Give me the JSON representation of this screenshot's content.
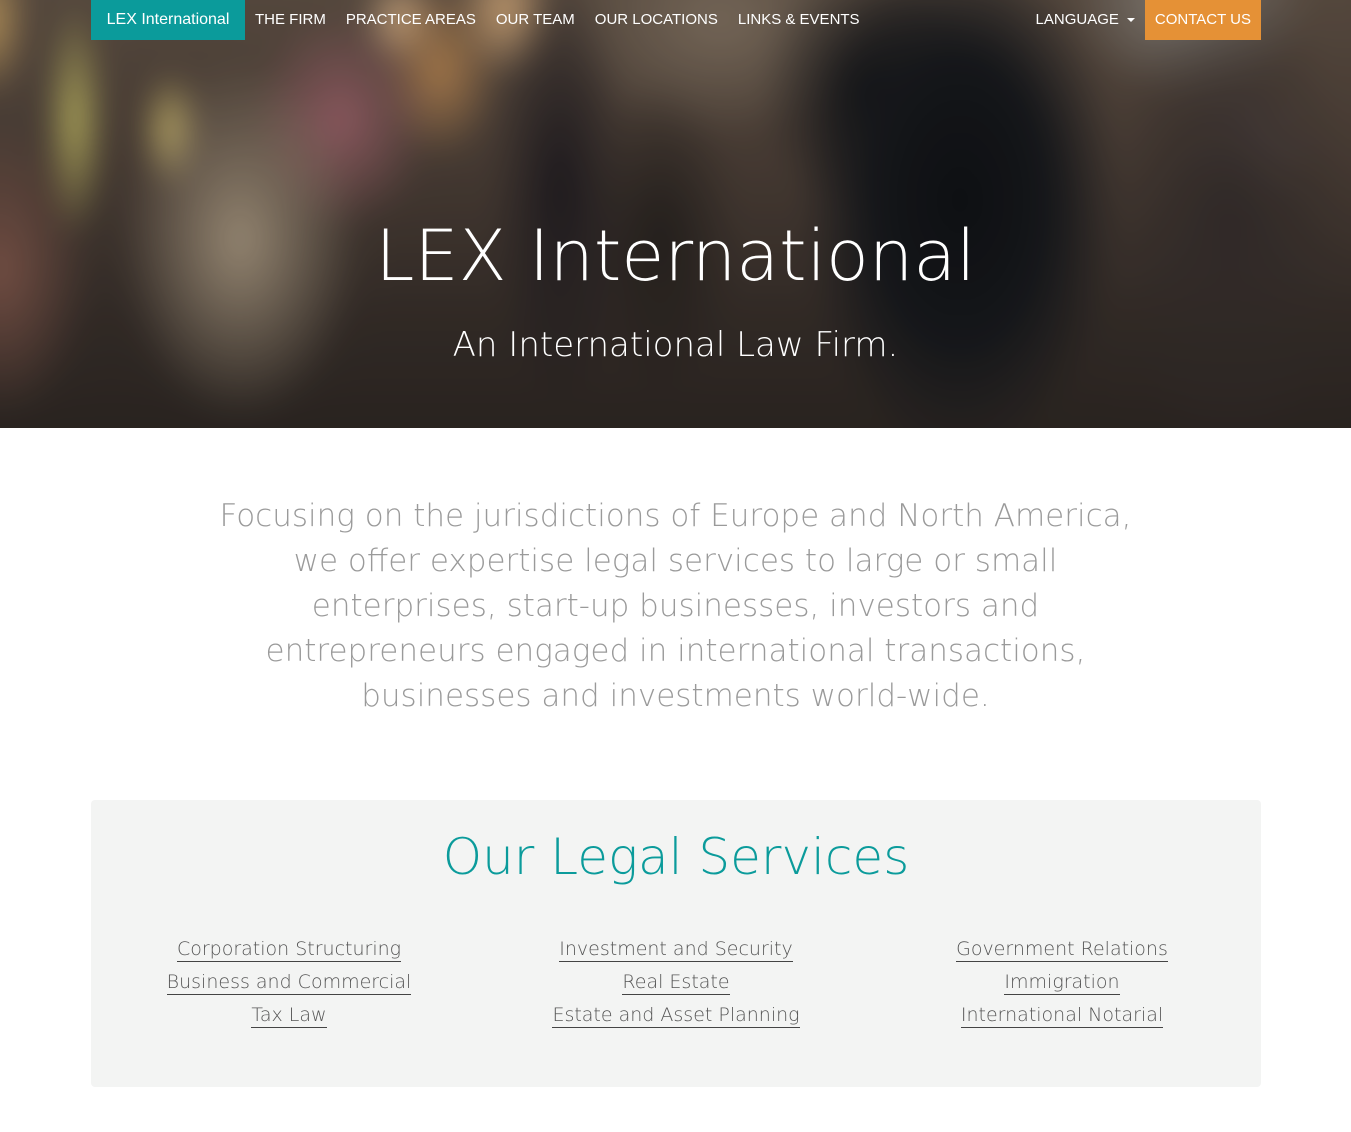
{
  "navbar": {
    "brand": "LEX International",
    "links": [
      "THE FIRM",
      "PRACTICE AREAS",
      "OUR TEAM",
      "OUR LOCATIONS",
      "LINKS & EVENTS"
    ],
    "language_label": "LANGUAGE",
    "contact_label": "CONTACT US",
    "brand_color": "#0b9b9b",
    "contact_color": "#e59136"
  },
  "hero": {
    "title": "LEX International",
    "subtitle": "An International Law Firm."
  },
  "intro": {
    "text": "Focusing on the jurisdictions of Europe and North America, we offer expertise legal services to large or small enterprises, start-up businesses, investors and entrepreneurs engaged in international transactions, businesses and investments world-wide."
  },
  "services": {
    "title": "Our Legal Services",
    "columns": [
      [
        "Corporation Structuring",
        "Business and Commercial",
        "Tax Law"
      ],
      [
        "Investment and Security",
        "Real Estate",
        "Estate and Asset Planning"
      ],
      [
        "Government Relations",
        "Immigration",
        "International Notarial"
      ]
    ]
  }
}
